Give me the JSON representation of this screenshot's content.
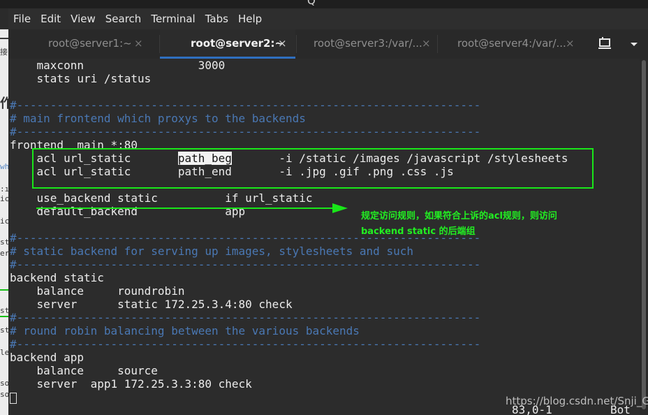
{
  "window": {
    "title_glyph": "Q"
  },
  "menu": [
    "File",
    "Edit",
    "View",
    "Search",
    "Terminal",
    "Tabs",
    "Help"
  ],
  "tabs": [
    {
      "label": "root@server1:~",
      "active": false
    },
    {
      "label": "root@server2:~",
      "active": true
    },
    {
      "label": "root@server3:/var/...",
      "active": false
    },
    {
      "label": "root@server4:/var/...",
      "active": false
    }
  ],
  "tab_close_glyph": "×",
  "terminal": {
    "lines": [
      "    maxconn                 3000",
      "    stats uri /status",
      "",
      "#---------------------------------------------------------------------",
      "# main frontend which proxys to the backends",
      "#---------------------------------------------------------------------",
      "frontend  main *:80",
      "    acl url_static       path_beg       -i /static /images /javascript /stylesheets",
      "    acl url_static       path_end       -i .jpg .gif .png .css .js",
      "",
      "    use_backend static          if url_static",
      "    default_backend             app",
      "",
      "#---------------------------------------------------------------------",
      "# static backend for serving up images, stylesheets and such",
      "#---------------------------------------------------------------------",
      "backend static",
      "    balance     roundrobin",
      "    server      static 172.25.3.4:80 check",
      "",
      "#---------------------------------------------------------------------",
      "# round robin balancing between the various backends",
      "#---------------------------------------------------------------------",
      "backend app",
      "    balance     source",
      "    server  app1 172.25.3.3:80 check"
    ],
    "highlight": {
      "prefix": "    acl url_static       ",
      "word": "path_beg",
      "suffix": "       -i /static /images /javascript /stylesheets"
    },
    "status_position": "83,0-1",
    "status_scroll": "Bot"
  },
  "annotation": {
    "line1": "规定访问规则，如果符合上诉的acl规则，则访问",
    "line2": "backend static 的后端组",
    "color": "#22ee22"
  },
  "watermark": "https://blog.csdn.net/Snji_G",
  "left_strip_chars": [
    "接",
    "作",
    "wh",
    ":ı",
    "ic",
    "ic",
    "st",
    "er",
    "st",
    "st",
    "le",
    "so",
    "so"
  ]
}
